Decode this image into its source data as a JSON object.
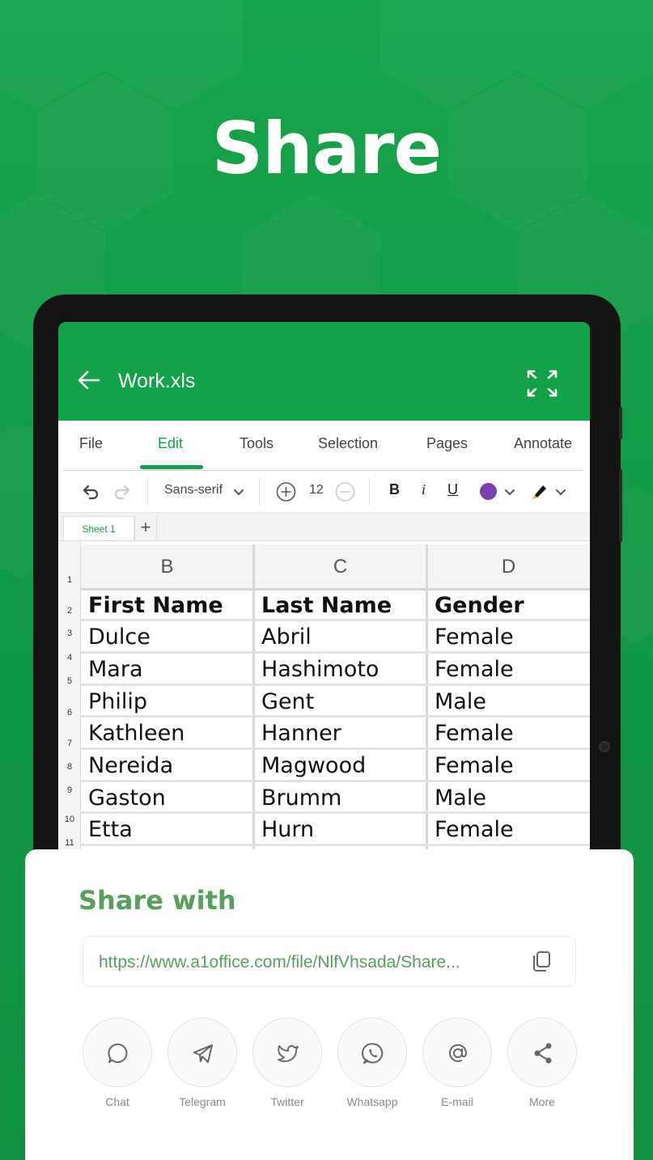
{
  "hero": {
    "title": "Share"
  },
  "document": {
    "title": "Work.xls"
  },
  "menu": {
    "tabs": [
      "File",
      "Edit",
      "Tools",
      "Selection",
      "Pages",
      "Annotate"
    ],
    "active_tab": "Edit"
  },
  "toolbar": {
    "font_family": "Sans-serif",
    "font_size": "12",
    "bold": "B",
    "italic": "i",
    "underline": "U",
    "text_color": "#7b3fb0",
    "highlight_color": "#f0a500"
  },
  "sheets": {
    "active": "Sheet 1",
    "add_label": "+"
  },
  "spreadsheet": {
    "columns": [
      "B",
      "C",
      "D"
    ],
    "row_numbers": [
      "1",
      "2",
      "3",
      "4",
      "5",
      "6",
      "7",
      "8",
      "9",
      "10",
      "11"
    ],
    "header": [
      "First Name",
      "Last Name",
      "Gender"
    ],
    "rows": [
      [
        "Dulce",
        "Abril",
        "Female"
      ],
      [
        "Mara",
        "Hashimoto",
        "Female"
      ],
      [
        "Philip",
        "Gent",
        "Male"
      ],
      [
        "Kathleen",
        "Hanner",
        "Female"
      ],
      [
        "Nereida",
        "Magwood",
        "Female"
      ],
      [
        "Gaston",
        "Brumm",
        "Male"
      ],
      [
        "Etta",
        "Hurn",
        "Female"
      ]
    ]
  },
  "share": {
    "title": "Share with",
    "link": "https://www.a1office.com/file/NlfVhsada/Share...",
    "options": [
      {
        "label": "Chat",
        "icon": "chat-icon"
      },
      {
        "label": "Telegram",
        "icon": "telegram-icon"
      },
      {
        "label": "Twitter",
        "icon": "twitter-icon"
      },
      {
        "label": "Whatsapp",
        "icon": "whatsapp-icon"
      },
      {
        "label": "E-mail",
        "icon": "email-icon"
      },
      {
        "label": "More",
        "icon": "share-icon"
      }
    ]
  },
  "colors": {
    "brand_green": "#12a147",
    "accent_green": "#55a05a"
  }
}
